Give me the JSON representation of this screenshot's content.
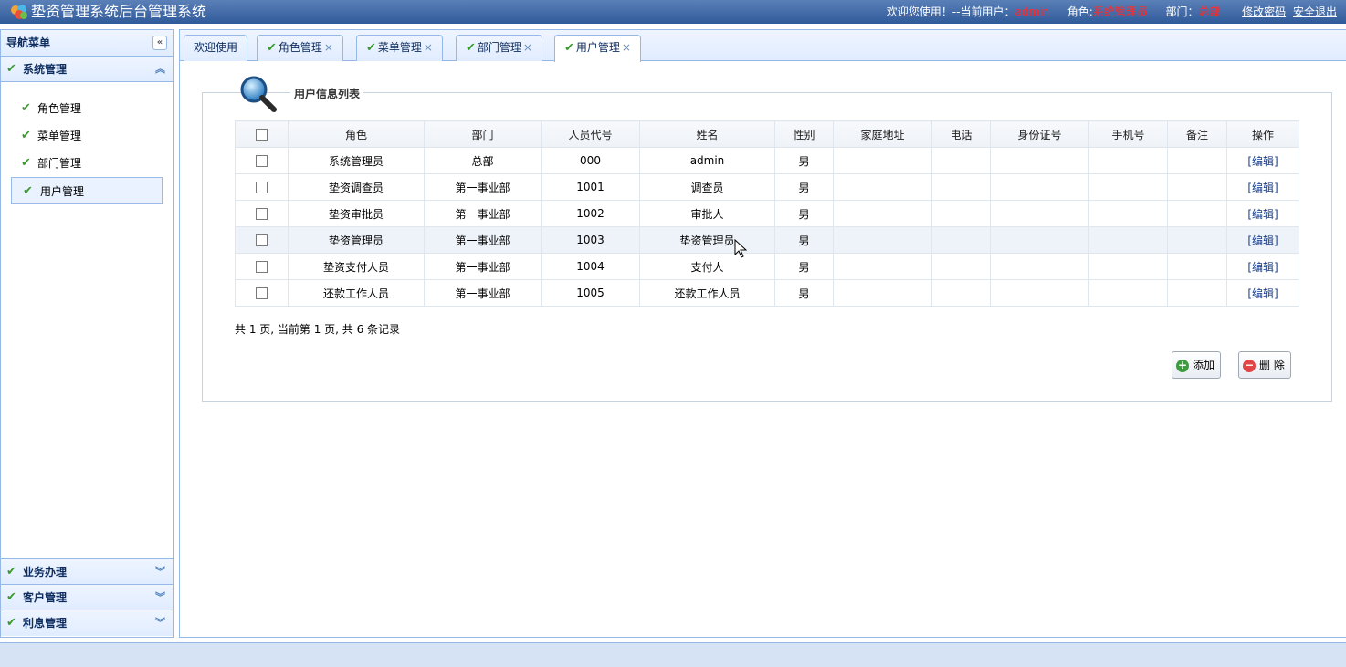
{
  "header": {
    "title": "垫资管理系统后台管理系统",
    "welcome": "欢迎您使用！--当前用户：",
    "user": "admin",
    "role_label": "角色:",
    "role": "系统管理员",
    "dept_label": "部门：",
    "dept": "总部",
    "change_pwd": "修改密码",
    "logout": "安全退出"
  },
  "nav": {
    "title": "导航菜单",
    "sections": [
      {
        "label": "系统管理",
        "items": [
          "角色管理",
          "菜单管理",
          "部门管理",
          "用户管理"
        ],
        "active_item": "用户管理"
      },
      {
        "label": "业务办理"
      },
      {
        "label": "客户管理"
      },
      {
        "label": "利息管理"
      }
    ]
  },
  "tabs": [
    {
      "label": "欢迎使用"
    },
    {
      "label": "角色管理"
    },
    {
      "label": "菜单管理"
    },
    {
      "label": "部门管理"
    },
    {
      "label": "用户管理"
    }
  ],
  "panel": {
    "legend": "用户信息列表",
    "columns": [
      "角色",
      "部门",
      "人员代号",
      "姓名",
      "性别",
      "家庭地址",
      "电话",
      "身份证号",
      "手机号",
      "备注",
      "操作"
    ],
    "rows": [
      {
        "role": "系统管理员",
        "dept": "总部",
        "code": "000",
        "name": "admin",
        "sex": "男",
        "op": "[编辑]"
      },
      {
        "role": "垫资调查员",
        "dept": "第一事业部",
        "code": "1001",
        "name": "调查员",
        "sex": "男",
        "op": "[编辑]"
      },
      {
        "role": "垫资审批员",
        "dept": "第一事业部",
        "code": "1002",
        "name": "审批人",
        "sex": "男",
        "op": "[编辑]"
      },
      {
        "role": "垫资管理员",
        "dept": "第一事业部",
        "code": "1003",
        "name": "垫资管理员",
        "sex": "男",
        "op": "[编辑]"
      },
      {
        "role": "垫资支付人员",
        "dept": "第一事业部",
        "code": "1004",
        "name": "支付人",
        "sex": "男",
        "op": "[编辑]"
      },
      {
        "role": "还款工作人员",
        "dept": "第一事业部",
        "code": "1005",
        "name": "还款工作人员",
        "sex": "男",
        "op": "[编辑]"
      }
    ],
    "pager": "共 1 页, 当前第 1 页, 共 6 条记录",
    "add_label": "添加",
    "delete_label": "删 除"
  },
  "colors": {
    "accent": "#2f5a99",
    "border": "#95b8e7",
    "check": "#3a9a2e",
    "highlight": "#ff2a2a"
  }
}
